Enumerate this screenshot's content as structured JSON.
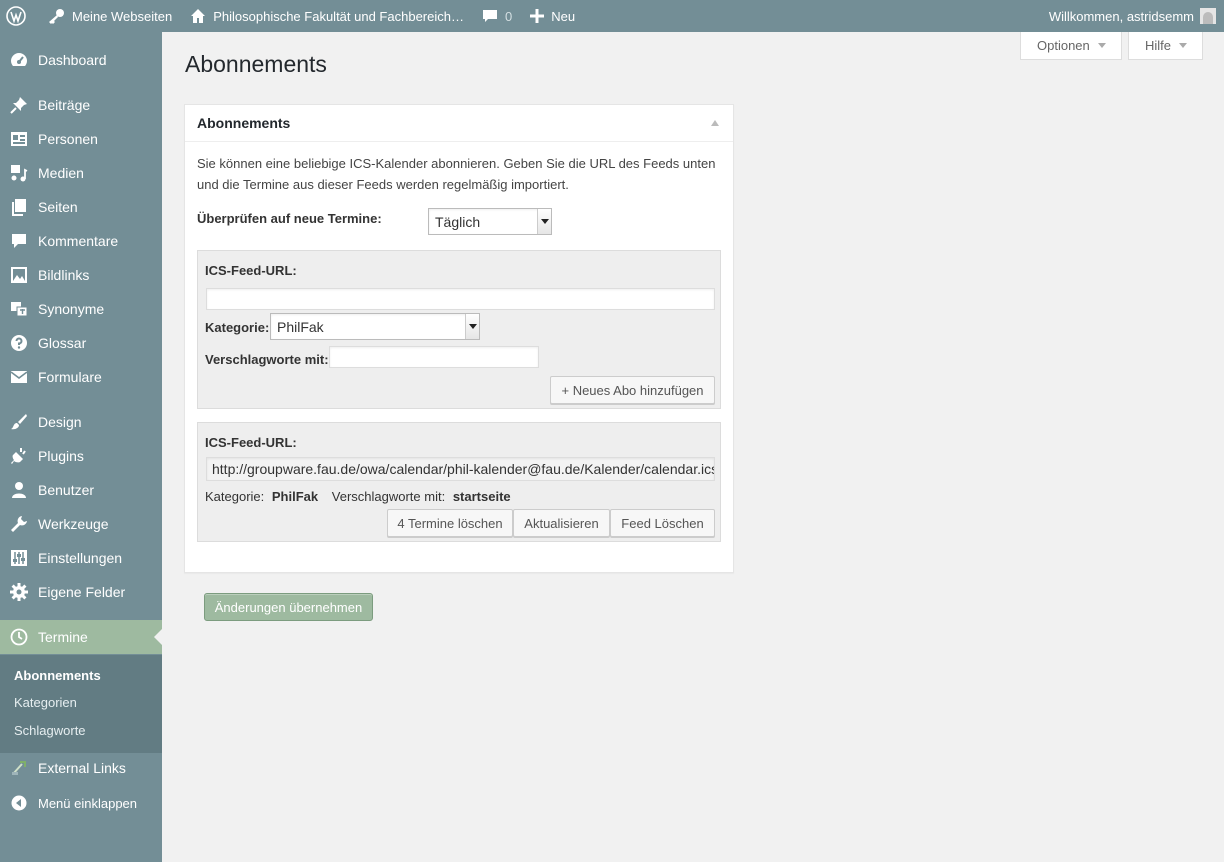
{
  "adminbar": {
    "my_sites": "Meine Webseiten",
    "site_name": "Philosophische Fakultät und Fachbereich…",
    "comments_count": "0",
    "new_label": "Neu",
    "greeting": "Willkommen, astridsemm"
  },
  "screen_meta": {
    "options_label": "Optionen",
    "help_label": "Hilfe"
  },
  "sidebar": {
    "items": [
      {
        "label": "Dashboard",
        "icon": "dashboard-icon"
      },
      {
        "label": "Beiträge",
        "icon": "pin-icon"
      },
      {
        "label": "Personen",
        "icon": "id-card-icon"
      },
      {
        "label": "Medien",
        "icon": "media-icon"
      },
      {
        "label": "Seiten",
        "icon": "pages-icon"
      },
      {
        "label": "Kommentare",
        "icon": "comment-icon"
      },
      {
        "label": "Bildlinks",
        "icon": "image-icon"
      },
      {
        "label": "Synonyme",
        "icon": "translation-icon"
      },
      {
        "label": "Glossar",
        "icon": "help-icon"
      },
      {
        "label": "Formulare",
        "icon": "email-icon"
      },
      {
        "label": "Design",
        "icon": "brush-icon"
      },
      {
        "label": "Plugins",
        "icon": "plugin-icon"
      },
      {
        "label": "Benutzer",
        "icon": "user-icon"
      },
      {
        "label": "Werkzeuge",
        "icon": "wrench-icon"
      },
      {
        "label": "Einstellungen",
        "icon": "settings-icon"
      },
      {
        "label": "Eigene Felder",
        "icon": "gear-icon"
      },
      {
        "label": "Termine",
        "icon": "clock-icon"
      },
      {
        "label": "External Links",
        "icon": "external-links-icon"
      },
      {
        "label": "Menü einklappen",
        "icon": "collapse-icon"
      }
    ],
    "submenu": [
      "Abonnements",
      "Kategorien",
      "Schlagworte"
    ]
  },
  "page": {
    "title": "Abonnements",
    "box_title": "Abonnements",
    "description": "Sie können eine beliebige ICS-Kalender abonnieren. Geben Sie die URL des Feeds unten und die Termine aus dieser Feeds werden regelmäßig importiert.",
    "check_label": "Überprüfen auf neue Termine:",
    "check_value": "Täglich",
    "new_feed": {
      "url_label": "ICS-Feed-URL:",
      "url_value": "",
      "category_label": "Kategorie:",
      "category_value": "PhilFak",
      "keywords_label": "Verschlagworte mit:",
      "keywords_value": "",
      "add_button": "+ Neues Abo hinzufügen"
    },
    "existing_feed": {
      "url_label": "ICS-Feed-URL:",
      "url_value": "http://groupware.fau.de/owa/calendar/phil-kalender@fau.de/Kalender/calendar.ics",
      "category_label": "Kategorie:",
      "category_value": "PhilFak",
      "keywords_label": "Verschlagworte mit:",
      "keywords_value": "startseite",
      "delete_events_button": "4 Termine löschen",
      "update_button": "Aktualisieren",
      "delete_feed_button": "Feed Löschen"
    },
    "save_button": "Änderungen übernehmen"
  },
  "colors": {
    "sidebar": "#738e96",
    "submenu": "#627c83",
    "accent": "#9ebaa0"
  }
}
